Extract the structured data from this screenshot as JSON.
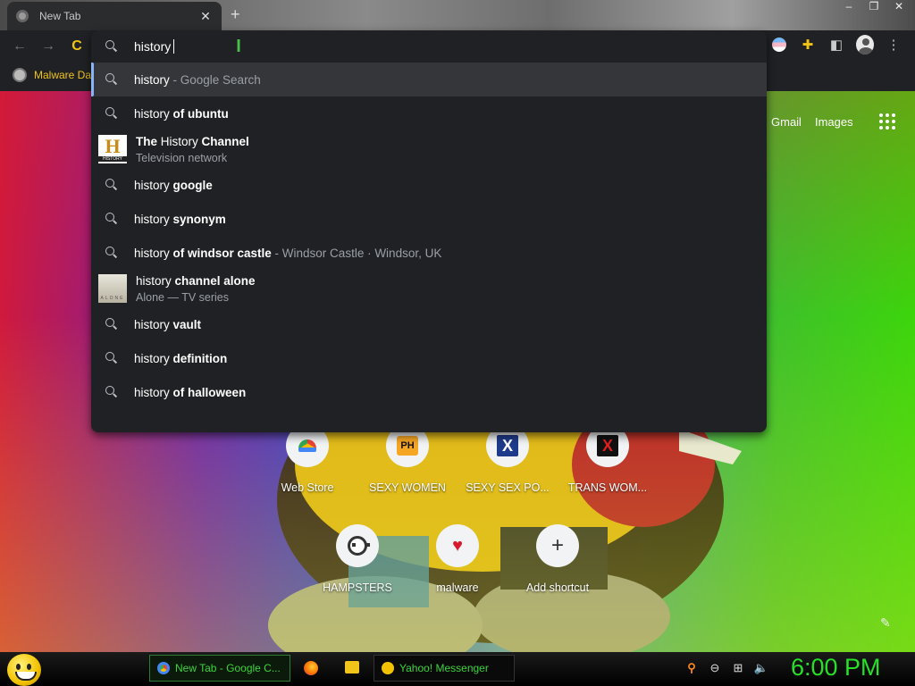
{
  "browser": {
    "tab": {
      "title": "New Tab",
      "close": "✕"
    },
    "new_tab": "+",
    "window_controls": [
      "–",
      "❐",
      "✕"
    ],
    "nav": {
      "back": "←",
      "forward": "→",
      "reload": "C"
    },
    "bookmarks": [
      {
        "label": "Malware Da",
        "icon": "globe-icon"
      }
    ]
  },
  "omnibox": {
    "query": "history",
    "suggestions": [
      {
        "prefix": "history",
        "bold": "",
        "muted": " - Google Search",
        "kind": "search",
        "selected": true
      },
      {
        "prefix": "history ",
        "bold": "of ubuntu",
        "muted": "",
        "kind": "search"
      },
      {
        "pre_bold": "The ",
        "prefix": "History ",
        "bold": "Channel",
        "sub": "Television network",
        "kind": "entity-history"
      },
      {
        "prefix": "history ",
        "bold": "google",
        "muted": "",
        "kind": "search"
      },
      {
        "prefix": "history ",
        "bold": "synonym",
        "muted": "",
        "kind": "search"
      },
      {
        "prefix": "history ",
        "bold": "of windsor castle",
        "muted": " - Windsor Castle · Windsor, UK",
        "kind": "search"
      },
      {
        "prefix": "history ",
        "bold": "channel alone",
        "sub": "Alone — TV series",
        "kind": "entity-alone"
      },
      {
        "prefix": "history ",
        "bold": "vault",
        "muted": "",
        "kind": "search"
      },
      {
        "prefix": "history ",
        "bold": "definition",
        "muted": "",
        "kind": "search"
      },
      {
        "prefix": "history ",
        "bold": "of halloween",
        "muted": "",
        "kind": "search"
      }
    ],
    "thumb_history": {
      "letter": "H",
      "caption": "HISTORY"
    },
    "thumb_alone": {
      "caption": "ALONE"
    }
  },
  "ntp": {
    "links": [
      "Gmail",
      "Images"
    ],
    "shortcuts": [
      {
        "label": "Web Store",
        "icon": "webstore-icon"
      },
      {
        "label": "SEXY WOMEN",
        "icon": "ph-icon",
        "glyph": "PH"
      },
      {
        "label": "SEXY SEX PO...",
        "icon": "x-blue-icon",
        "glyph": "X"
      },
      {
        "label": "TRANS WOM...",
        "icon": "x-red-icon",
        "glyph": "X"
      },
      {
        "label": "HAMPSTERS",
        "icon": "panda-icon"
      },
      {
        "label": "malware",
        "icon": "heart-icon",
        "glyph": "♥"
      },
      {
        "label": "Add shortcut",
        "icon": "plus-icon",
        "glyph": "+"
      }
    ]
  },
  "taskbar": {
    "chrome_task": "New Tab - Google C...",
    "yahoo_task": "Yahoo! Messenger",
    "clock": "6:00 PM"
  },
  "colors": {
    "accent_green": "#27e027",
    "bookmark_yellow": "#f0c419",
    "selection_blue": "#8ab4f8"
  }
}
